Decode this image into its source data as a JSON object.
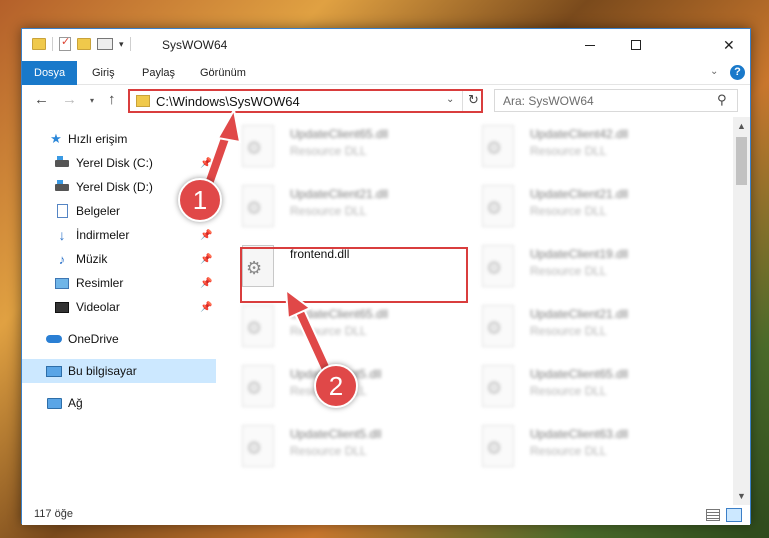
{
  "window": {
    "title": "SysWOW64",
    "minimize_label": "",
    "maximize_label": "",
    "close_label": "✕"
  },
  "ribbon": {
    "tabs": [
      "Dosya",
      "Giriş",
      "Paylaş",
      "Görünüm"
    ],
    "help": "?"
  },
  "nav": {
    "back": "←",
    "forward": "→",
    "recent": "▾",
    "up": "↑",
    "address": "C:\\Windows\\SysWOW64",
    "refresh": "↻",
    "search_placeholder": "Ara: SysWOW64"
  },
  "sidebar": {
    "items": [
      {
        "label": "Hızlı erişim",
        "icon": "star-icon"
      },
      {
        "label": "Yerel Disk (C:)",
        "icon": "drive-icon",
        "pinned": true
      },
      {
        "label": "Yerel Disk (D:)",
        "icon": "drive-icon",
        "pinned": true
      },
      {
        "label": "Belgeler",
        "icon": "documents-icon",
        "pinned": true
      },
      {
        "label": "İndirmeler",
        "icon": "downloads-icon",
        "pinned": true
      },
      {
        "label": "Müzik",
        "icon": "music-icon",
        "pinned": true
      },
      {
        "label": "Resimler",
        "icon": "pictures-icon",
        "pinned": true
      },
      {
        "label": "Videolar",
        "icon": "videos-icon",
        "pinned": true
      },
      {
        "label": "OneDrive",
        "icon": "onedrive-icon"
      },
      {
        "label": "Bu bilgisayar",
        "icon": "this-pc-icon",
        "selected": true
      },
      {
        "label": "Ağ",
        "icon": "network-icon"
      }
    ]
  },
  "files": [
    {
      "name": "UpdateClient65.dll",
      "type": "Resource DLL"
    },
    {
      "name": "UpdateClient42.dll",
      "type": "Resource DLL"
    },
    {
      "name": "UpdateClient21.dll",
      "type": "Resource DLL"
    },
    {
      "name": "UpdateClient21.dll",
      "type": "Resource DLL"
    },
    {
      "name": "frontend.dll",
      "type": ""
    },
    {
      "name": "UpdateClient19.dll",
      "type": "Resource DLL"
    },
    {
      "name": "UpdateClient65.dll",
      "type": "Resource DLL"
    },
    {
      "name": "UpdateClient21.dll",
      "type": "Resource DLL"
    },
    {
      "name": "UpdateClient5.dll",
      "type": "Resource DLL"
    },
    {
      "name": "UpdateClient65.dll",
      "type": "Resource DLL"
    },
    {
      "name": "UpdateClient5.dll",
      "type": "Resource DLL"
    },
    {
      "name": "UpdateClient63.dll",
      "type": "Resource DLL"
    }
  ],
  "status": {
    "item_count": "117 öğe"
  },
  "callouts": {
    "step1": "1",
    "step2": "2"
  }
}
